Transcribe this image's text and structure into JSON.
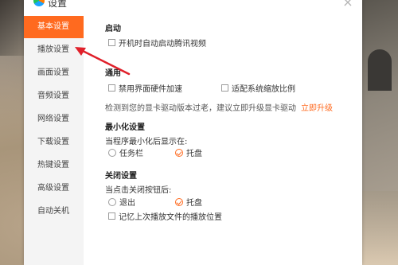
{
  "window": {
    "title": "设置"
  },
  "sidebar": {
    "items": [
      {
        "label": "基本设置",
        "active": true
      },
      {
        "label": "播放设置"
      },
      {
        "label": "画面设置"
      },
      {
        "label": "音频设置"
      },
      {
        "label": "网络设置"
      },
      {
        "label": "下载设置"
      },
      {
        "label": "热键设置"
      },
      {
        "label": "高级设置"
      },
      {
        "label": "自动关机"
      }
    ]
  },
  "startup": {
    "title": "启动",
    "autostart_label": "开机时自动启动腾讯视频"
  },
  "general": {
    "title": "通用",
    "hw_accel_label": "禁用界面硬件加速",
    "scale_label": "适配系统缩放比例",
    "driver_notice": "检测到您的显卡驱动版本过老，建议立即升级显卡驱动",
    "upgrade_link": "立即升级"
  },
  "minimize": {
    "title": "最小化设置",
    "prompt": "当程序最小化后显示在:",
    "option_taskbar": "任务栏",
    "option_tray": "托盘",
    "selected": "托盘"
  },
  "close": {
    "title": "关闭设置",
    "prompt": "当点击关闭按钮后:",
    "option_exit": "退出",
    "option_tray": "托盘",
    "selected": "托盘",
    "remember_label": "记忆上次播放文件的播放位置"
  },
  "colors": {
    "accent": "#ff6a1f",
    "annotation_arrow": "#e0202a"
  }
}
